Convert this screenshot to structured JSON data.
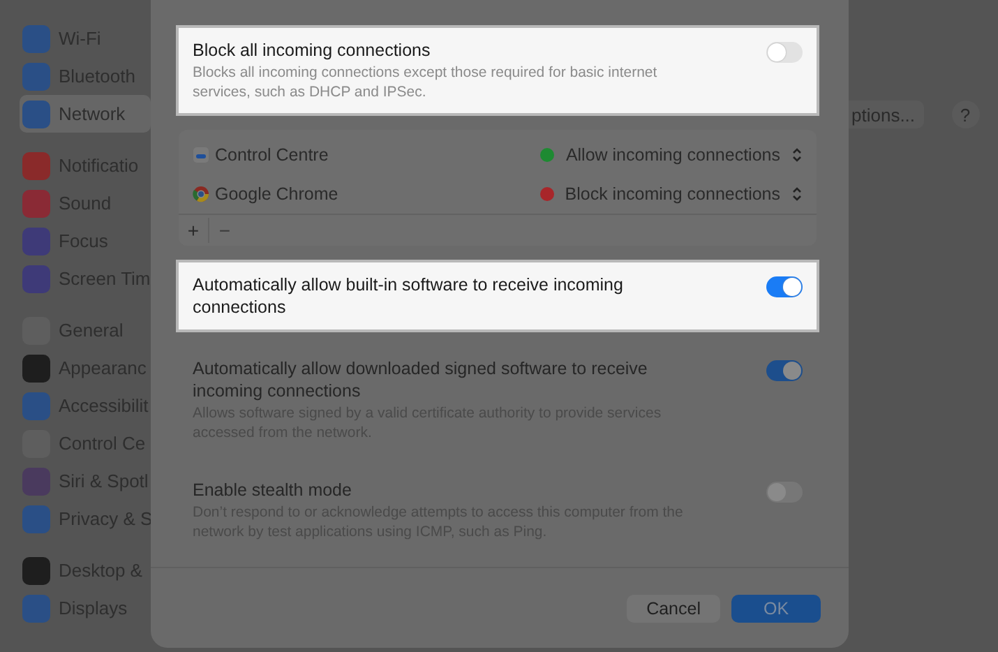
{
  "sidebar": {
    "groups": [
      {
        "items": [
          {
            "label": "Wi-Fi",
            "color": "#2a4f86",
            "selected": false
          },
          {
            "label": "Bluetooth",
            "color": "#2a4f86",
            "selected": false
          },
          {
            "label": "Network",
            "color": "#2a4f86",
            "selected": true
          }
        ]
      },
      {
        "items": [
          {
            "label": "Notificatio",
            "color": "#8a2a2a",
            "selected": false
          },
          {
            "label": "Sound",
            "color": "#8a2a35",
            "selected": false
          },
          {
            "label": "Focus",
            "color": "#3e3a78",
            "selected": false
          },
          {
            "label": "Screen Tim",
            "color": "#3e3a78",
            "selected": false
          }
        ]
      },
      {
        "items": [
          {
            "label": "General",
            "color": "#5e5e5e",
            "selected": false
          },
          {
            "label": "Appearanc",
            "color": "#1e1e1e",
            "selected": false
          },
          {
            "label": "Accessibilit",
            "color": "#2a4f86",
            "selected": false
          },
          {
            "label": "Control Ce",
            "color": "#5e5e5e",
            "selected": false
          },
          {
            "label": "Siri & Spotl",
            "color": "#4a3a5e",
            "selected": false
          },
          {
            "label": "Privacy & S",
            "color": "#2a4f86",
            "selected": false
          }
        ]
      },
      {
        "items": [
          {
            "label": "Desktop &",
            "color": "#1e1e1e",
            "selected": false
          },
          {
            "label": "Displays",
            "color": "#2a4f86",
            "selected": false
          }
        ]
      }
    ]
  },
  "options_button": "ptions...",
  "help_button": "?",
  "dialog": {
    "block_all": {
      "title": "Block all incoming connections",
      "description": "Blocks all incoming connections except those required for basic internet services, such as DHCP and IPSec.",
      "on": false,
      "highlighted": true
    },
    "apps": [
      {
        "name": "Control Centre",
        "status": "Allow incoming connections",
        "color": "#1e8a32"
      },
      {
        "name": "Google Chrome",
        "status": "Block incoming connections",
        "color": "#a8262a"
      }
    ],
    "add_button": "+",
    "remove_button": "−",
    "settings": [
      {
        "title": "Automatically allow built-in software to receive incoming connections",
        "on": true,
        "highlighted": true
      },
      {
        "title": "Automatically allow downloaded signed software to receive incoming connections",
        "description": "Allows software signed by a valid certificate authority to provide services accessed from the network.",
        "on": true,
        "highlighted": false
      },
      {
        "title": "Enable stealth mode",
        "description": "Don’t respond to or acknowledge attempts to access this computer from the network by test applications using ICMP, such as Ping.",
        "on": false,
        "highlighted": false
      }
    ],
    "buttons": [
      "Cancel",
      "OK"
    ]
  }
}
